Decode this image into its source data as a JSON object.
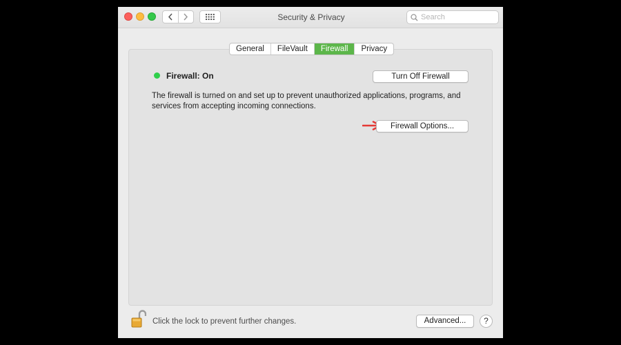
{
  "window": {
    "title": "Security & Privacy"
  },
  "toolbar": {
    "search_placeholder": "Search",
    "back_icon": "chevron-left-icon",
    "forward_icon": "chevron-right-icon",
    "grid_icon": "show-all-grid-icon"
  },
  "tabs": [
    {
      "label": "General",
      "active": false
    },
    {
      "label": "FileVault",
      "active": false
    },
    {
      "label": "Firewall",
      "active": true
    },
    {
      "label": "Privacy",
      "active": false
    }
  ],
  "firewall": {
    "status": "Firewall: On",
    "status_color": "#2fcf4b",
    "turn_off_label": "Turn Off Firewall",
    "description": "The firewall is turned on and set up to prevent unauthorized applications, programs, and services from accepting incoming connections.",
    "options_label": "Firewall Options..."
  },
  "footer": {
    "lock_text": "Click the lock to prevent further changes.",
    "advanced_label": "Advanced...",
    "help_label": "?"
  },
  "colors": {
    "accent_tab": "#5cb64a",
    "annotation_arrow": "#e53935"
  }
}
